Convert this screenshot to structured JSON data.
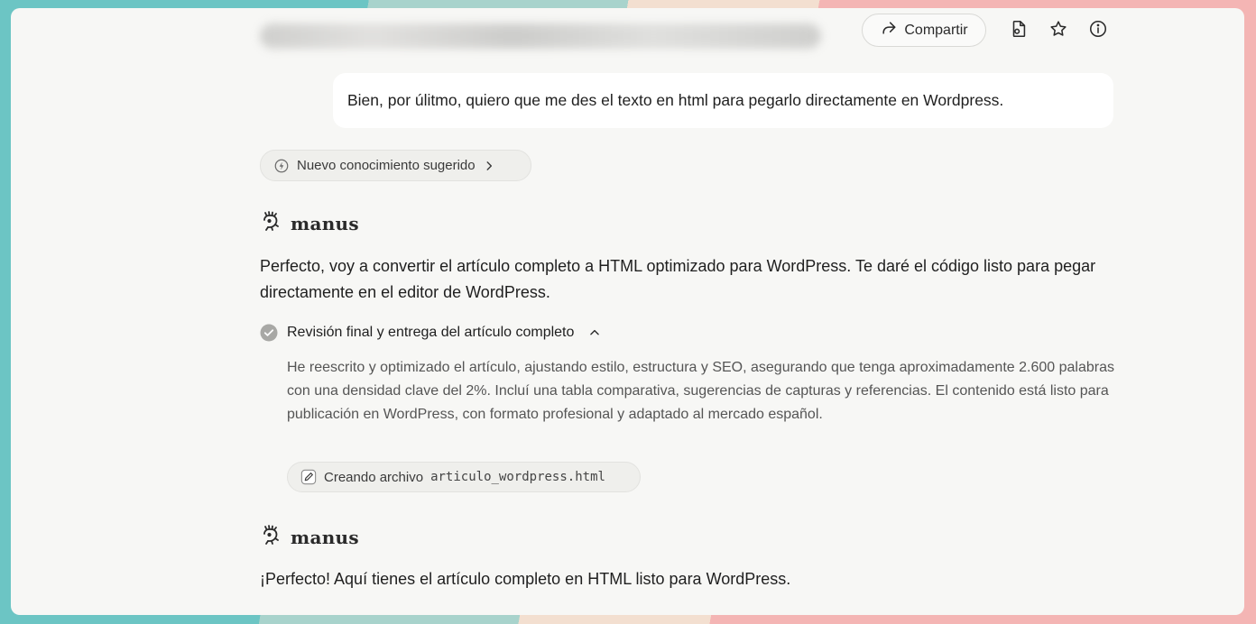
{
  "header": {
    "share_label": "Compartir",
    "icons": [
      "share-icon",
      "file-icon",
      "star-icon",
      "info-icon"
    ]
  },
  "user_message": "Bien, por úlitmo, quiero que me des el texto en html para pegarlo directamente en Wordpress.",
  "knowledge_chip": {
    "label": "Nuevo conocimiento sugerido",
    "icons": [
      "bolt-icon",
      "chevron-right-icon"
    ]
  },
  "assistant": {
    "brand_name": "manus",
    "intro": "Perfecto, voy a convertir el artículo completo a HTML optimizado para WordPress. Te daré el código listo para pegar directamente en el editor de WordPress.",
    "task": {
      "title": "Revisión final y entrega del artículo completo",
      "status": "completed",
      "summary": "He reescrito y optimizado el artículo, ajustando estilo, estructura y SEO, asegurando que tenga aproximadamente 2.600 palabras con una densidad clave del 2%. Incluí una tabla comparativa, sugerencias de capturas y referencias. El contenido está listo para publicación en WordPress, con formato profesional y adaptado al mercado español.",
      "action": {
        "label": "Creando archivo",
        "filename": "articulo_wordpress.html"
      }
    },
    "reply": "¡Perfecto! Aquí tienes el artículo completo en HTML listo para WordPress."
  },
  "colors": {
    "window_bg": "#f7f7f5",
    "bubble_bg": "#ffffff",
    "chip_bg": "#efefec",
    "check_gray": "#a8a8a5",
    "bg_teal": "#6cc5c4",
    "bg_mint": "#a8d3cc",
    "bg_cream": "#f3dfd0",
    "bg_pink": "#f4b5b4"
  }
}
